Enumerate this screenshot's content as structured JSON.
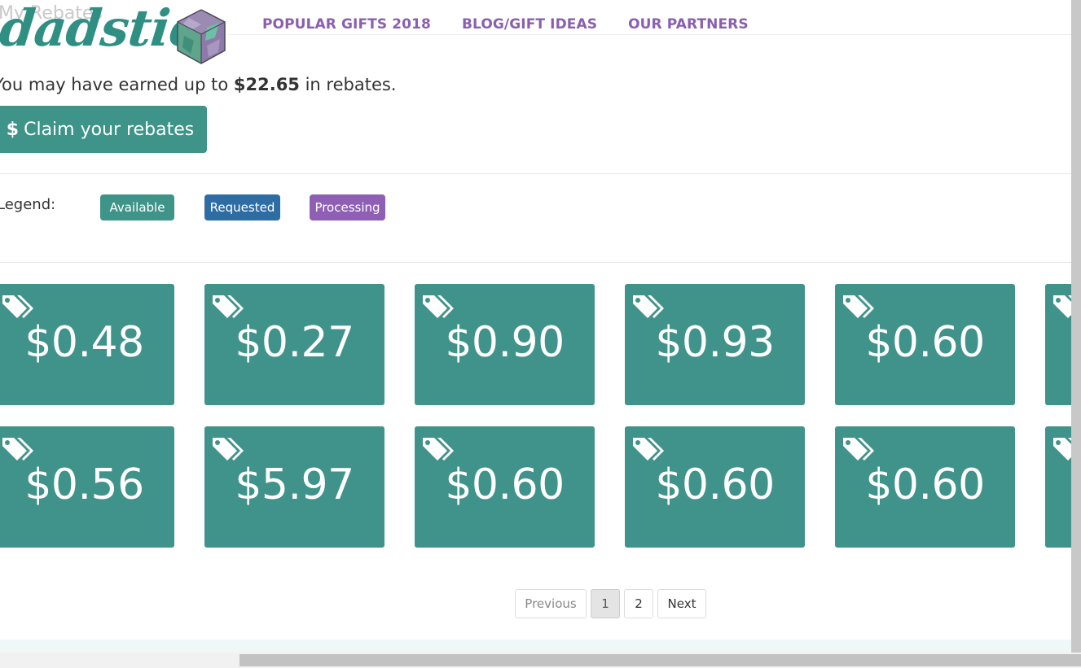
{
  "page": {
    "ghost_title": "My Rebates"
  },
  "header": {
    "logo_text": "dadstie",
    "nav": [
      "POPULAR GIFTS 2018",
      "BLOG/GIFT IDEAS",
      "OUR PARTNERS"
    ]
  },
  "summary": {
    "prefix": "You may have earned up to ",
    "amount": "$22.65",
    "suffix": " in rebates."
  },
  "claim_button": {
    "icon": "dollar-icon",
    "label": "Claim your rebates"
  },
  "legend": {
    "label": "Legend:",
    "items": [
      {
        "label": "Available",
        "color": "#3e9488"
      },
      {
        "label": "Requested",
        "color": "#2e6da4"
      },
      {
        "label": "Processing",
        "color": "#8e5fb5"
      }
    ]
  },
  "rebates": {
    "row1": [
      "$0.48",
      "$0.27",
      "$0.90",
      "$0.93",
      "$0.60",
      ""
    ],
    "row2": [
      "$0.56",
      "$5.97",
      "$0.60",
      "$0.60",
      "$0.60",
      ""
    ],
    "card_color": "#40938a",
    "card_icon": "tags-icon"
  },
  "pagination": {
    "previous": "Previous",
    "pages": [
      "1",
      "2"
    ],
    "current": "1",
    "next": "Next"
  },
  "colors": {
    "brand": "#2f8f83",
    "nav": "#8a5fae"
  }
}
